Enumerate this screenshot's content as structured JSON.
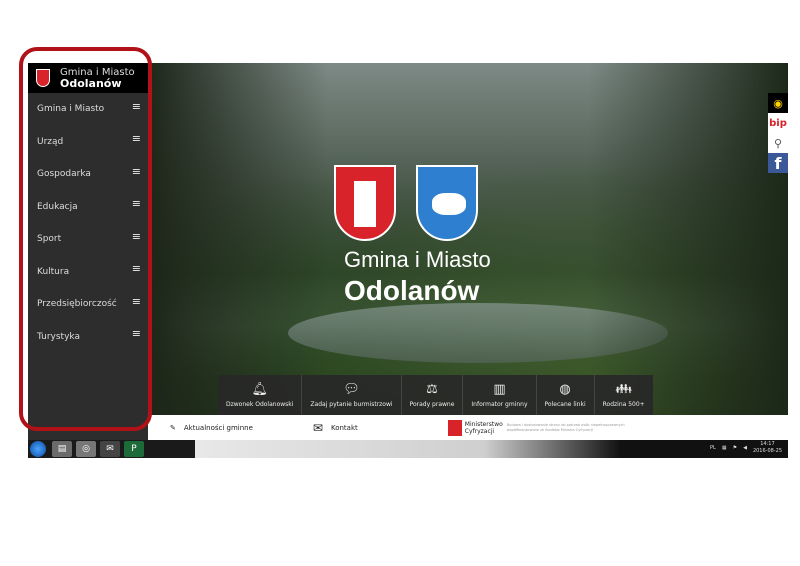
{
  "sidebar": {
    "title_line1": "Gmina i Miasto",
    "title_line2": "Odolanów",
    "items": [
      {
        "label": "Gmina i Miasto"
      },
      {
        "label": "Urząd"
      },
      {
        "label": "Gospodarka"
      },
      {
        "label": "Edukacja"
      },
      {
        "label": "Sport"
      },
      {
        "label": "Kultura"
      },
      {
        "label": "Przedsiębiorczość"
      },
      {
        "label": "Turystyka"
      }
    ]
  },
  "hero": {
    "title_line1": "Gmina i Miasto",
    "title_line2": "Odolanów"
  },
  "side_tools": {
    "bip": "bip",
    "facebook": "f"
  },
  "quick_links": [
    {
      "icon": "bell-icon",
      "label": "Dzwonek Odolanowski"
    },
    {
      "icon": "chat-icon",
      "label": "Zadaj pytanie burmistrzowi"
    },
    {
      "icon": "handshake-icon",
      "label": "Porady prawne"
    },
    {
      "icon": "map-icon",
      "label": "Informator gminny"
    },
    {
      "icon": "globe-icon",
      "label": "Polecane linki"
    },
    {
      "icon": "family-icon",
      "label": "Rodzina 500+"
    }
  ],
  "bottom": {
    "news": "Aktualności gminne",
    "contact": "Kontakt",
    "ministry_line1": "Ministerstwo",
    "ministry_line2": "Cyfryzacji",
    "ministry_note": "Budowa i dostosowanie strony do potrzeb osób niepełnosprawnych współfinansowane ze środków Ministra Cyfryzacji"
  },
  "taskbar": {
    "lang": "PL",
    "time": "14:17",
    "date": "2016-08-25"
  },
  "colors": {
    "annotation": "#b01218",
    "brand_red": "#d8232a",
    "sidebar": "#2d2d2d"
  }
}
